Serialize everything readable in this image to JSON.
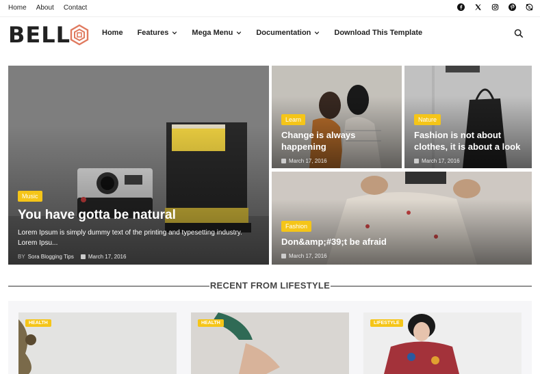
{
  "topbar": {
    "links": [
      "Home",
      "About",
      "Contact"
    ],
    "social_icons": [
      "facebook-icon",
      "x-icon",
      "instagram-icon",
      "pinterest-icon",
      "skype-icon"
    ]
  },
  "header": {
    "logo_text": "BELL",
    "nav": {
      "home": "Home",
      "features": "Features",
      "mega_menu": "Mega Menu",
      "documentation": "Documentation",
      "download": "Download This Template"
    }
  },
  "featured": [
    {
      "label": "Music",
      "title": "You have gotta be natural",
      "excerpt": "Lorem Ipsum is simply dummy text of the printing and typesetting industry. Lorem Ipsu...",
      "by": "BY",
      "author": "Sora Blogging Tips",
      "date": "March 17, 2016"
    },
    {
      "label": "Learn",
      "title": "Change is always happening",
      "date": "March 17, 2016"
    },
    {
      "label": "Nature",
      "title": "Fashion is not about clothes, it is about a look",
      "date": "March 17, 2016"
    },
    {
      "label": "Fashion",
      "title": "Don&amp;#39;t be afraid",
      "date": "March 17, 2016"
    }
  ],
  "section": {
    "title": "RECENT FROM LIFESTYLE"
  },
  "recent": [
    {
      "label": "HEALTH"
    },
    {
      "label": "HEALTH"
    },
    {
      "label": "LIFESTYLE"
    }
  ],
  "colors": {
    "accent": "#f5c518",
    "logo_accent": "#e07a5f",
    "text": "#222222"
  }
}
